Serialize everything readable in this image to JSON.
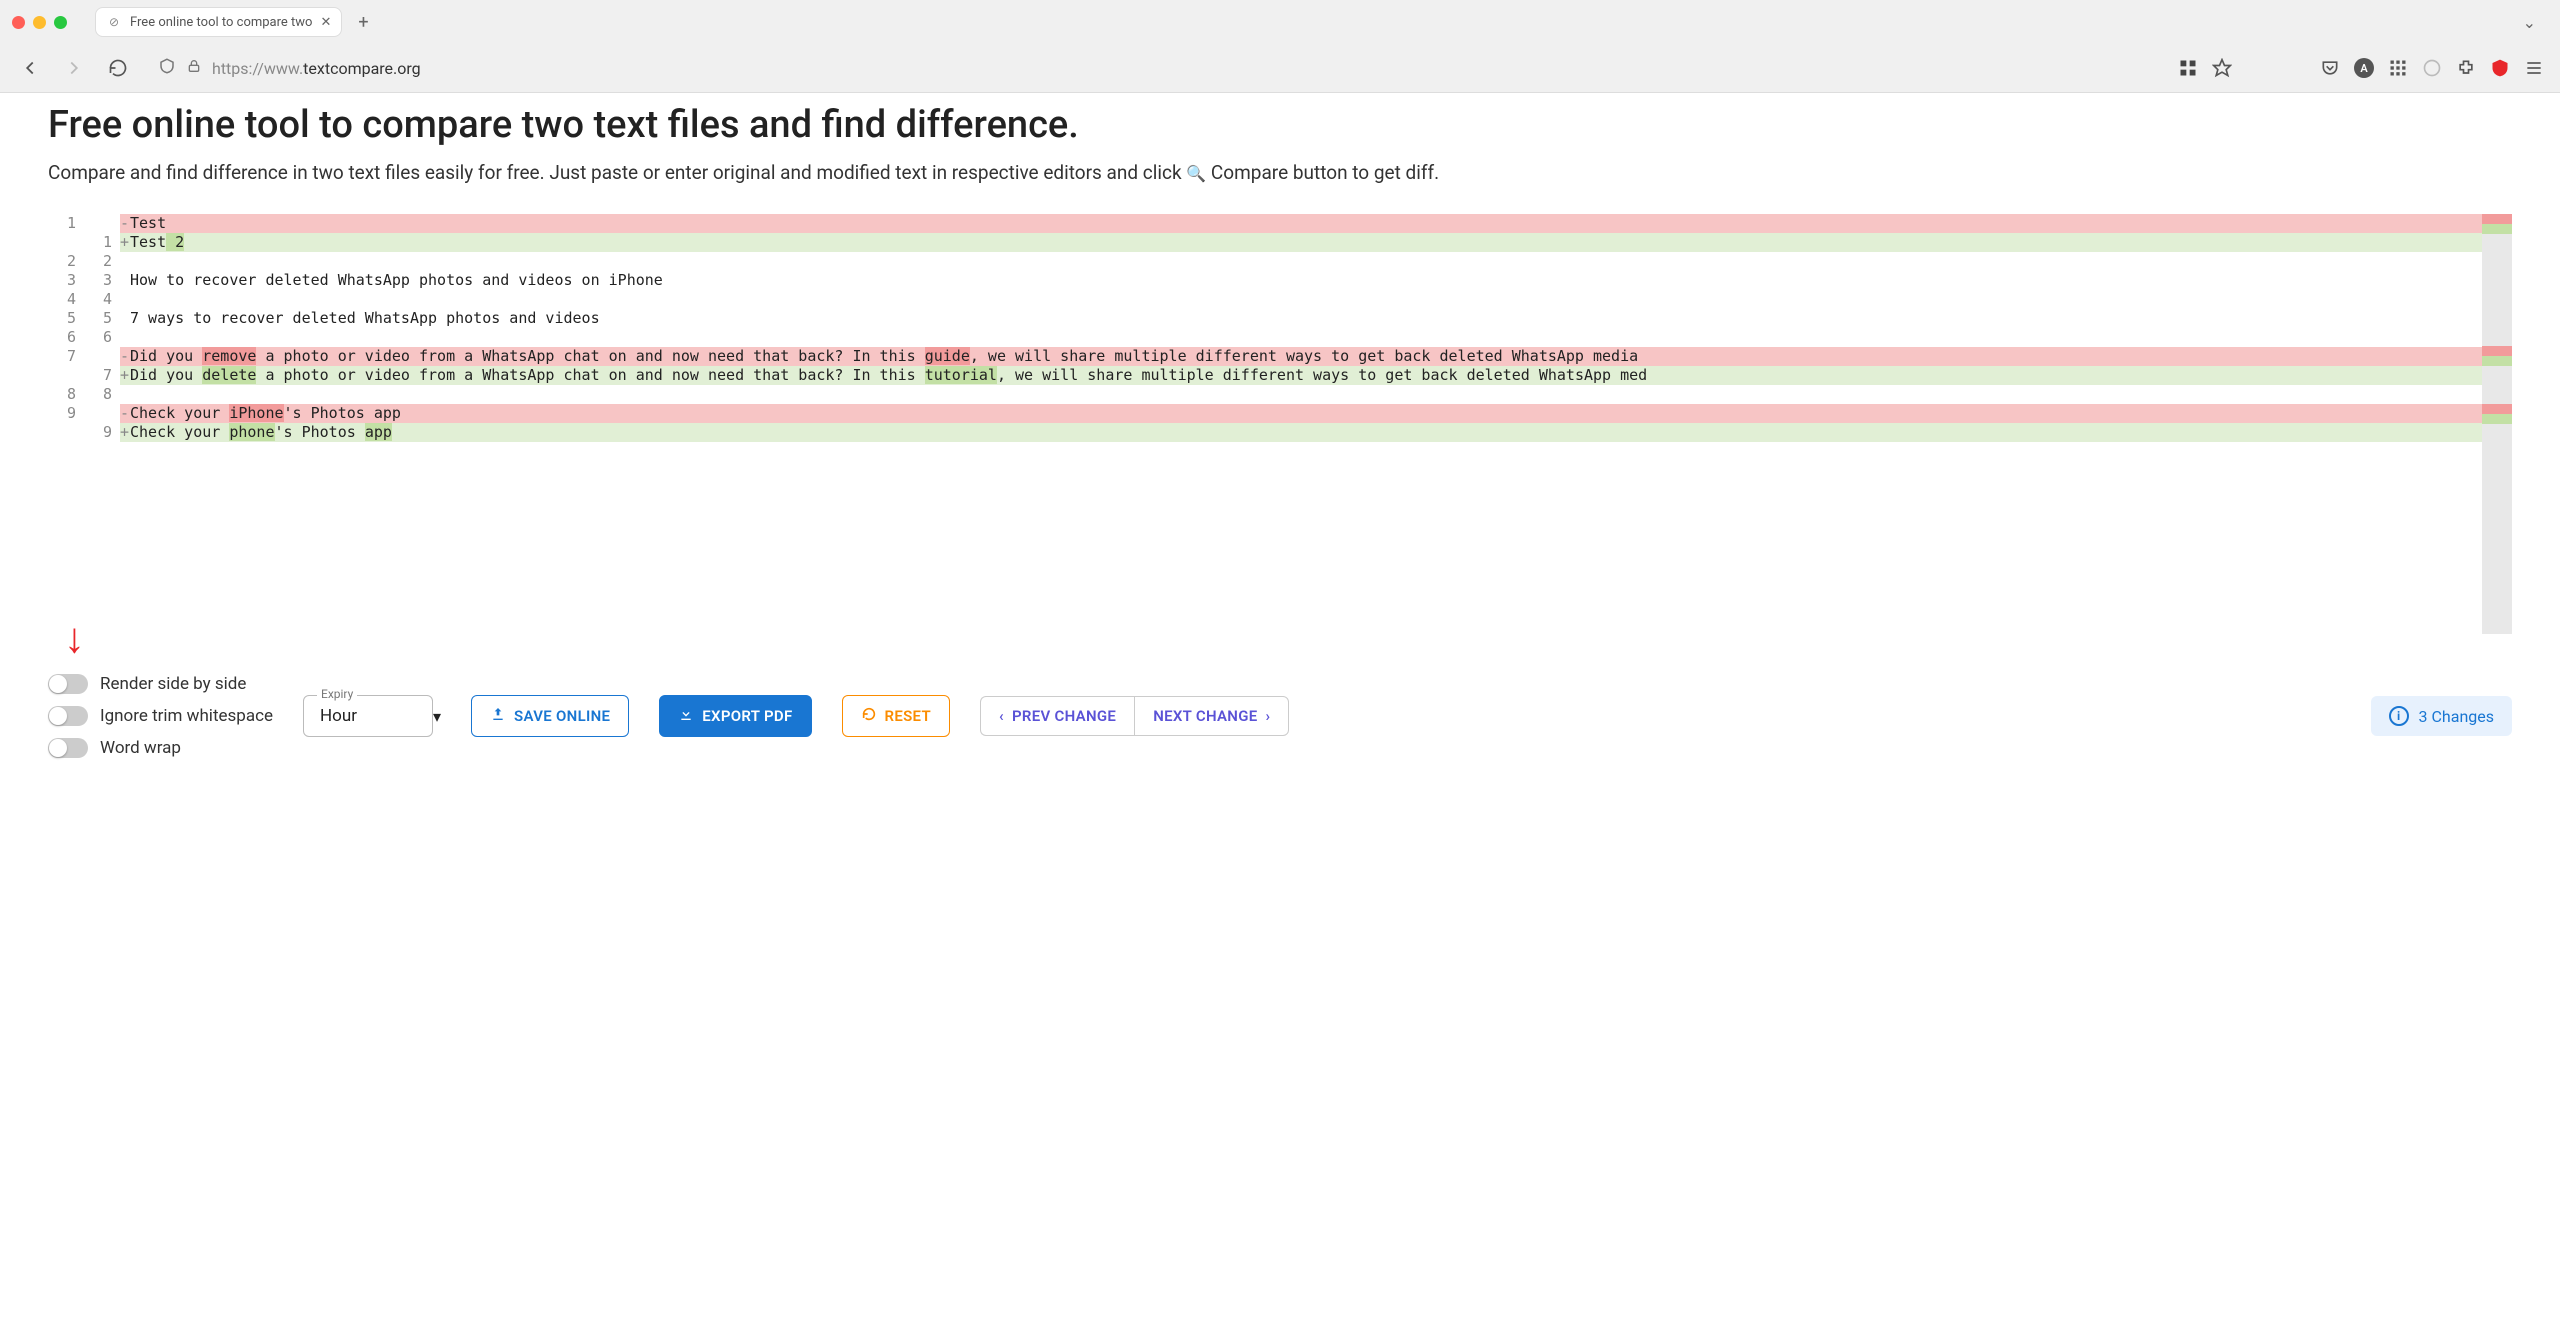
{
  "browser": {
    "tab_title": "Free online tool to compare two",
    "url_proto": "https://www.",
    "url_rest": "textcompare.org",
    "avatar_initial": "A"
  },
  "page": {
    "heading": "Free online tool to compare two text files and find difference.",
    "sub_a": "Compare and find difference in two text files easily for free. Just paste or enter original and modified text in respective editors and click ",
    "sub_b": " Compare button to get diff."
  },
  "diff": {
    "left_gutter": [
      "1",
      "",
      "2",
      "3",
      "4",
      "5",
      "6",
      "7",
      "",
      "8",
      "9",
      ""
    ],
    "right_gutter": [
      "",
      "1",
      "2",
      "3",
      "4",
      "5",
      "6",
      "",
      "7",
      "8",
      "",
      "9"
    ],
    "lines": [
      {
        "sign": "-",
        "cls": "del",
        "text": "Test"
      },
      {
        "sign": "+",
        "cls": "add",
        "pre": "Test",
        "hl": " 2",
        "post": ""
      },
      {
        "sign": "",
        "cls": "",
        "text": ""
      },
      {
        "sign": "",
        "cls": "",
        "text": "How to recover deleted WhatsApp photos and videos on iPhone"
      },
      {
        "sign": "",
        "cls": "",
        "text": ""
      },
      {
        "sign": "",
        "cls": "",
        "text": "7 ways to recover deleted WhatsApp photos and videos"
      },
      {
        "sign": "",
        "cls": "",
        "text": ""
      },
      {
        "sign": "-",
        "cls": "del",
        "pre": "Did you ",
        "hl": "remove",
        "post": " a photo or video from a WhatsApp chat on and now need that back? In this ",
        "hl2": "guide",
        "post2": ", we will share multiple different ways to get back deleted WhatsApp media "
      },
      {
        "sign": "+",
        "cls": "add",
        "pre": "Did you ",
        "hl": "delete",
        "post": " a photo or video from a WhatsApp chat on and now need that back? In this ",
        "hl2": "tutorial",
        "post2": ", we will share multiple different ways to get back deleted WhatsApp med"
      },
      {
        "sign": "",
        "cls": "",
        "text": ""
      },
      {
        "sign": "-",
        "cls": "del",
        "pre": "Check your ",
        "hl": "iPhone",
        "post": "'s Photos app"
      },
      {
        "sign": "+",
        "cls": "add",
        "pre": "Check your ",
        "hl": "phone",
        "post": "'s Photos ",
        "hl2": "app",
        "post2": ""
      }
    ]
  },
  "annotation_arrow": "↓",
  "toggles": {
    "side_by_side": "Render side by side",
    "ignore_trim": "Ignore trim whitespace",
    "word_wrap": "Word wrap"
  },
  "expiry": {
    "label": "Expiry",
    "value": "Hour"
  },
  "buttons": {
    "save": "SAVE ONLINE",
    "export": "EXPORT PDF",
    "reset": "RESET",
    "prev": "PREV CHANGE",
    "next": "NEXT CHANGE"
  },
  "changes": {
    "count": "3 Changes",
    "info": "i"
  },
  "icons": {
    "magnifier": "🔍"
  }
}
